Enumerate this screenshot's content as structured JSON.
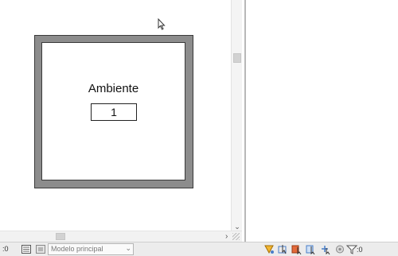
{
  "canvas": {
    "room": {
      "name": "Ambiente",
      "number": "1"
    }
  },
  "status_bar": {
    "left_value": ":0",
    "model_select": {
      "value": "Modelo principal"
    },
    "filter_count": ":0",
    "icons": [
      "worksets-icon",
      "design-options-icon",
      "select-links-icon",
      "select-underlay-icon",
      "select-pinned-icon",
      "select-by-face-icon",
      "drag-on-selection-icon",
      "background-processes-icon",
      "filter-icon"
    ]
  }
}
